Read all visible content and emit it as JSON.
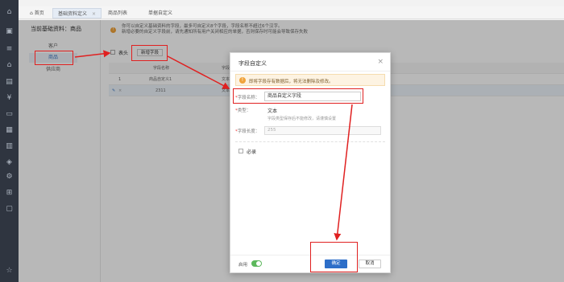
{
  "tabs": {
    "home": "首页",
    "base_def": "基础资料定义",
    "product_list": "商品列表",
    "single_def": "单据自定义"
  },
  "left_panel": {
    "title": "当前基础资料：商品",
    "items": [
      "客户",
      "商品",
      "供应商"
    ]
  },
  "notice": {
    "line1": "你可以自定义基础资料的字段，最多可自定义8个字段，字段名称不超过6个汉字。",
    "line2": "新增必要的自定义字段前，请先通知所有用户关闭相应的单据，否则保存时可能会导致保存失败"
  },
  "grid": {
    "header_checkbox_label": "表头",
    "add_field_button": "新增字段",
    "col_field_name": "字段名称",
    "col_type": "字段类型",
    "row1_index": "1",
    "row1_name": "商品自定义1",
    "row1_type": "文本",
    "row2_name": "2311",
    "row2_type": "文本"
  },
  "dialog": {
    "title": "字段自定义",
    "warning": "即将字段存有数据后，将无法删除及修改。",
    "name_label": "字段名称：",
    "name_value": "商品自定义字段",
    "type_label": "类型：",
    "type_value": "文本",
    "type_hint": "字段类型保存后不能修改，请谨慎设置",
    "length_label": "字段长度：",
    "length_value": "255",
    "required_label": "必录",
    "enable_label": "启用",
    "confirm_button": "确定",
    "cancel_button": "取消",
    "close_symbol": "×",
    "required_mark": "*"
  },
  "icons": {
    "warning": "warning-icon",
    "close": "close-icon"
  },
  "colors": {
    "primary": "#2d6ec8",
    "annotation": "#e02020",
    "toggle_on": "#5cb85c",
    "warning": "#f0a33a"
  }
}
